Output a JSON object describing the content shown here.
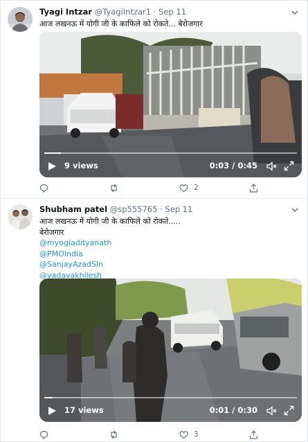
{
  "tweets": [
    {
      "author_name": "Tyagi Intzar",
      "handle": "@TyagiIntzar1",
      "separator": "·",
      "date": "Sep 11",
      "text_lines": [
        "आज लखनऊ में योगी जी के काफिले को रोकते... बेरोजगार"
      ],
      "mentions": [],
      "video": {
        "views": "9 views",
        "time": "0:03 / 0:45",
        "progress": 0.067
      },
      "actions": {
        "reply_count": "",
        "retweet_count": "",
        "like_count": "2"
      }
    },
    {
      "author_name": "Shubham patel",
      "handle": "@sp555765",
      "separator": "·",
      "date": "Sep 11",
      "text_lines": [
        "आज लखनऊ में योगी जी के काफिले को रोकते.....",
        "बेरोजगार"
      ],
      "mentions": [
        "@myogiadityanath",
        "@PMOIndia",
        "@SanjayAzadSln",
        "@yadavakhilesh"
      ],
      "video": {
        "views": "17 views",
        "time": "0:01 / 0:30",
        "progress": 0.033
      },
      "actions": {
        "reply_count": "",
        "retweet_count": "",
        "like_count": "3"
      }
    }
  ],
  "colors": {
    "link": "#1b95e0",
    "muted": "#5b7083",
    "text": "#0f1419",
    "divider": "#e6ecf0"
  },
  "icons": [
    "chevron-down-icon",
    "play-icon",
    "volume-muted-icon",
    "fullscreen-icon",
    "reply-icon",
    "retweet-icon",
    "like-icon",
    "share-icon"
  ]
}
